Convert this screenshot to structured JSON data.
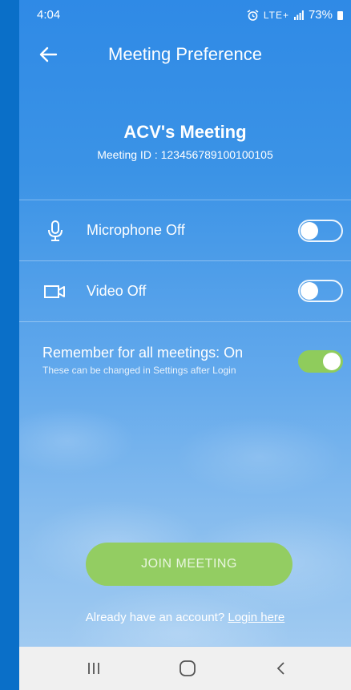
{
  "status_bar": {
    "time": "4:04",
    "network": "LTE+",
    "battery": "73%"
  },
  "header": {
    "title": "Meeting Preference",
    "back_icon": "arrow-left-icon"
  },
  "meeting": {
    "name": "ACV's Meeting",
    "id_text": "Meeting ID : 123456789100100105"
  },
  "settings": {
    "microphone": {
      "label": "Microphone Off",
      "icon": "microphone-icon",
      "enabled": false
    },
    "video": {
      "label": "Video Off",
      "icon": "video-camera-icon",
      "enabled": false
    },
    "remember": {
      "title": "Remember for all meetings: On",
      "subtitle": "These can be changed in Settings after Login",
      "enabled": true
    }
  },
  "actions": {
    "join_label": "JOIN MEETING",
    "login_prompt": "Already have an account? ",
    "login_link": "Login here"
  },
  "nav_bar": {
    "recents_icon": "recent-apps-icon",
    "home_icon": "home-icon",
    "back_icon": "back-chevron-icon"
  },
  "colors": {
    "accent_green": "#93cd62",
    "background_blue": "#2f8ae6",
    "nav_background": "#f0f0f0"
  }
}
